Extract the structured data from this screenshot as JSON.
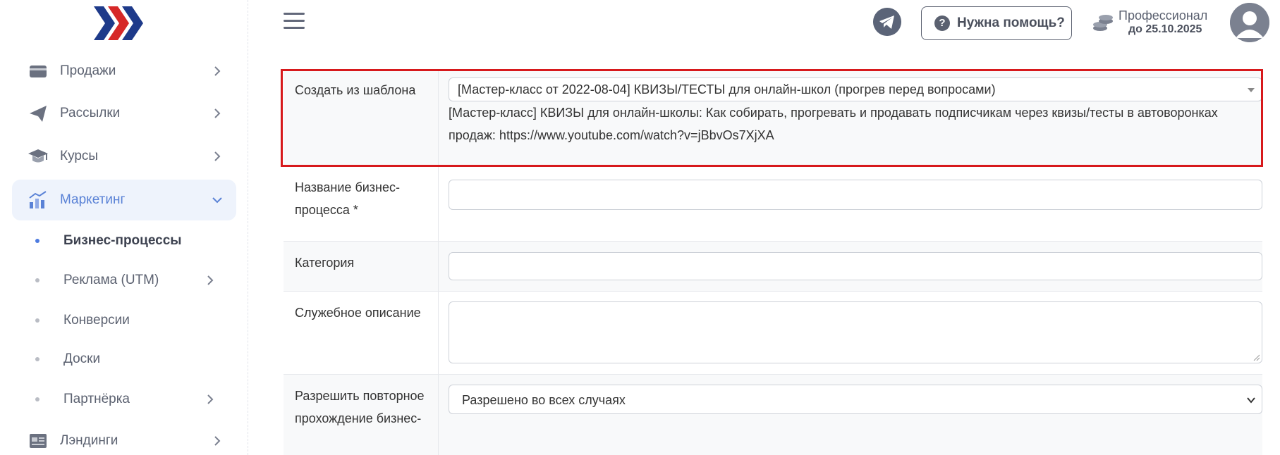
{
  "sidebar": {
    "items": [
      {
        "label": "Продажи",
        "icon": "wallet-icon"
      },
      {
        "label": "Рассылки",
        "icon": "paper-plane-icon"
      },
      {
        "label": "Курсы",
        "icon": "graduation-cap-icon"
      },
      {
        "label": "Маркетинг",
        "icon": "chart-icon"
      },
      {
        "label": "Лэндинги",
        "icon": "landing-page-icon"
      }
    ],
    "sub_items": [
      {
        "label": "Бизнес-процессы"
      },
      {
        "label": "Реклама (UTM)"
      },
      {
        "label": "Конверсии"
      },
      {
        "label": "Доски"
      },
      {
        "label": "Партнёрка"
      }
    ]
  },
  "header": {
    "help_label": "Нужна помощь?",
    "plan_name": "Профессионал",
    "plan_until": "до 25.10.2025"
  },
  "form": {
    "template": {
      "label": "Создать из шаблона",
      "selected": "[Мастер-класс от 2022-08-04] КВИЗЫ/ТЕСТЫ для онлайн-школ (прогрев перед вопросами)",
      "description": "[Мастер-класс] КВИЗЫ для онлайн-школы: Как собирать, прогревать и продавать подписчикам через квизы/тесты в автоворонках продаж: https://www.youtube.com/watch?v=jBbvOs7XjXA"
    },
    "name": {
      "label": "Название бизнес-процесса *",
      "value": ""
    },
    "category": {
      "label": "Категория",
      "value": ""
    },
    "description": {
      "label": "Служебное описание",
      "value": ""
    },
    "repeat": {
      "label": "Разрешить повторное прохождение бизнес-",
      "selected": "Разрешено во всех случаях"
    }
  },
  "colors": {
    "accent": "#5a82d6",
    "highlight": "#d7191c",
    "brand_blue": "#1e3a8a",
    "brand_red": "#d62828"
  }
}
